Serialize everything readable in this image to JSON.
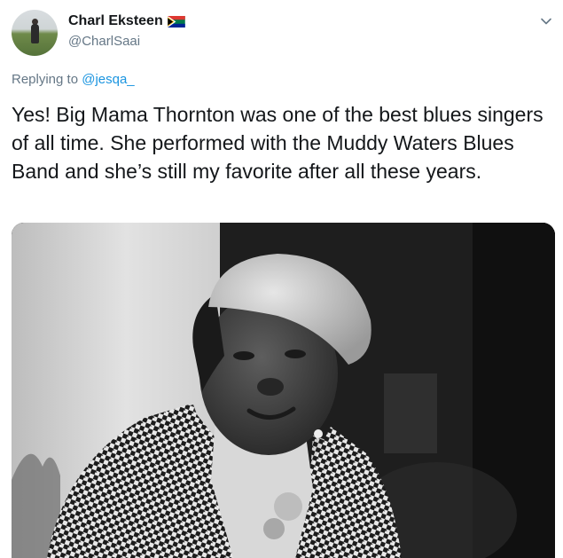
{
  "author": {
    "display_name": "Charl Eksteen",
    "handle": "@CharlSaai",
    "flag_icon": "south-africa-flag-icon"
  },
  "reply": {
    "prefix": "Replying to",
    "mention": "@jesqa_"
  },
  "tweet": {
    "text": "Yes! Big Mama Thornton was one of the best blues singers of all time. She performed with the Muddy Waters Blues Band and she’s still my favorite after all these years."
  },
  "media": {
    "type": "black-and-white photo"
  },
  "colors": {
    "text_primary": "#14171a",
    "text_secondary": "#657786",
    "link": "#1b95e0"
  }
}
